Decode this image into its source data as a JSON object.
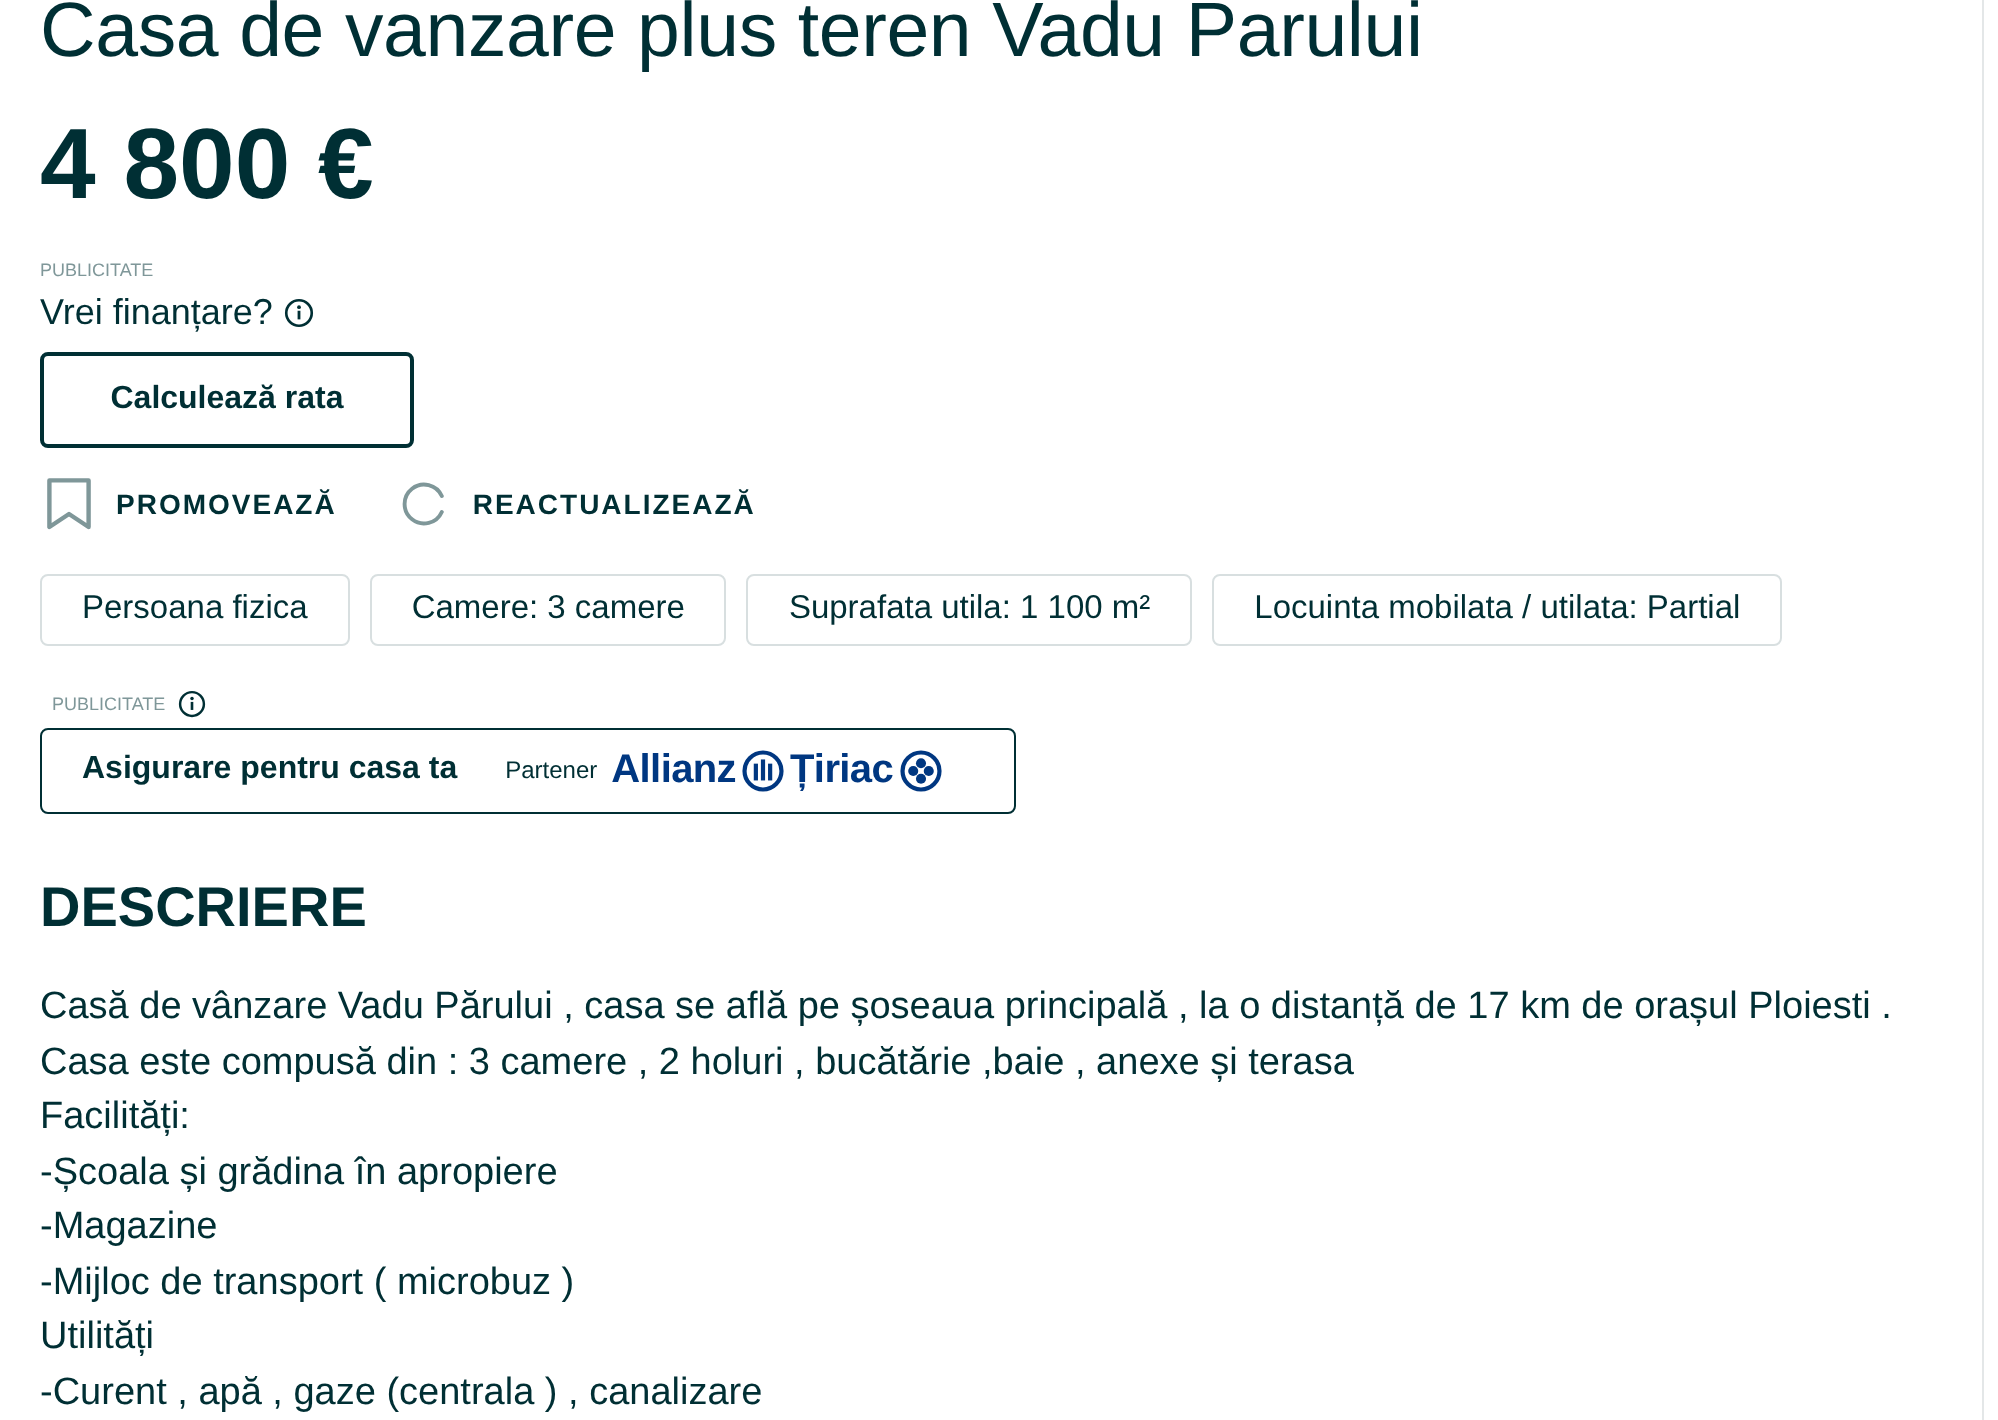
{
  "title": "Casa de vanzare plus teren Vadu Parului",
  "price": "4 800 €",
  "financing": {
    "ad_label": "PUBLICITATE",
    "question": "Vrei finanțare?",
    "button": "Calculează rata"
  },
  "actions": [
    {
      "kind": "bookmark",
      "label": "PROMOVEAZĂ"
    },
    {
      "kind": "refresh",
      "label": "REACTUALIZEAZĂ"
    }
  ],
  "parameters": [
    "Persoana fizica",
    "Camere: 3 camere",
    "Suprafata utila: 1 100 m²",
    "Locuinta mobilata / utilata: Partial"
  ],
  "insurance_ad": {
    "ad_label": "PUBLICITATE",
    "title": "Asigurare pentru casa ta",
    "partner_label": "Partener",
    "partner_name_1": "Allianz",
    "partner_name_2": "Țiriac"
  },
  "description": {
    "heading": "DESCRIERE",
    "lines": [
      "Casă de vânzare Vadu Părului , casa se află pe șoseaua principală , la o distanță de 17 km de orașul Ploiesti .",
      "Casa este compusă din : 3 camere , 2 holuri , bucătărie ,baie , anexe și terasa",
      "Facilități:",
      "-Școala și grădina în apropiere",
      "-Magazine",
      "-Mijloc de transport ( microbuz )",
      "Utilități",
      "-Curent , apă , gaze (centrala ) , canalizare"
    ]
  }
}
